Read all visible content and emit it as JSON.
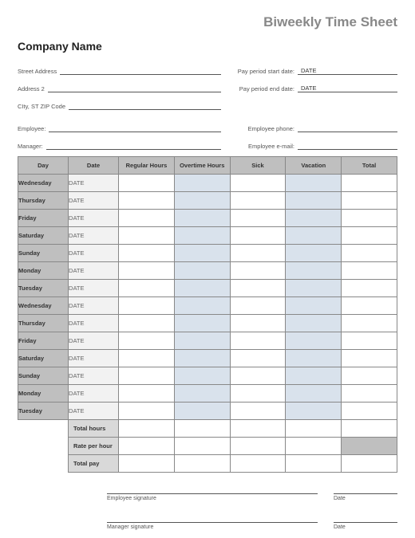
{
  "title": "Biweekly Time Sheet",
  "company": "Company Name",
  "address": {
    "street_label": "Street Address",
    "addr2_label": "Address 2",
    "csz_label": "CIty, ST  ZIP Code"
  },
  "period": {
    "start_label": "Pay period start date:",
    "start_value": "DATE",
    "end_label": "Pay period end date:",
    "end_value": "DATE"
  },
  "people": {
    "employee_label": "Employee:",
    "manager_label": "Manager:",
    "phone_label": "Employee phone:",
    "email_label": "Employee e-mail:"
  },
  "columns": {
    "day": "Day",
    "date": "Date",
    "regular": "Regular Hours",
    "overtime": "Overtime Hours",
    "sick": "Sick",
    "vacation": "Vacation",
    "total": "Total"
  },
  "rows": [
    {
      "day": "Wednesday",
      "date": "DATE"
    },
    {
      "day": "Thursday",
      "date": "DATE"
    },
    {
      "day": "Friday",
      "date": "DATE"
    },
    {
      "day": "Saturday",
      "date": "DATE"
    },
    {
      "day": "Sunday",
      "date": "DATE"
    },
    {
      "day": "Monday",
      "date": "DATE"
    },
    {
      "day": "Tuesday",
      "date": "DATE"
    },
    {
      "day": "Wednesday",
      "date": "DATE"
    },
    {
      "day": "Thursday",
      "date": "DATE"
    },
    {
      "day": "Friday",
      "date": "DATE"
    },
    {
      "day": "Saturday",
      "date": "DATE"
    },
    {
      "day": "Sunday",
      "date": "DATE"
    },
    {
      "day": "Monday",
      "date": "DATE"
    },
    {
      "day": "Tuesday",
      "date": "DATE"
    }
  ],
  "summary": {
    "total_hours": "Total hours",
    "rate": "Rate per hour",
    "total_pay": "Total pay"
  },
  "signatures": {
    "employee": "Employee signature",
    "manager": "Manager signature",
    "date": "Date"
  }
}
